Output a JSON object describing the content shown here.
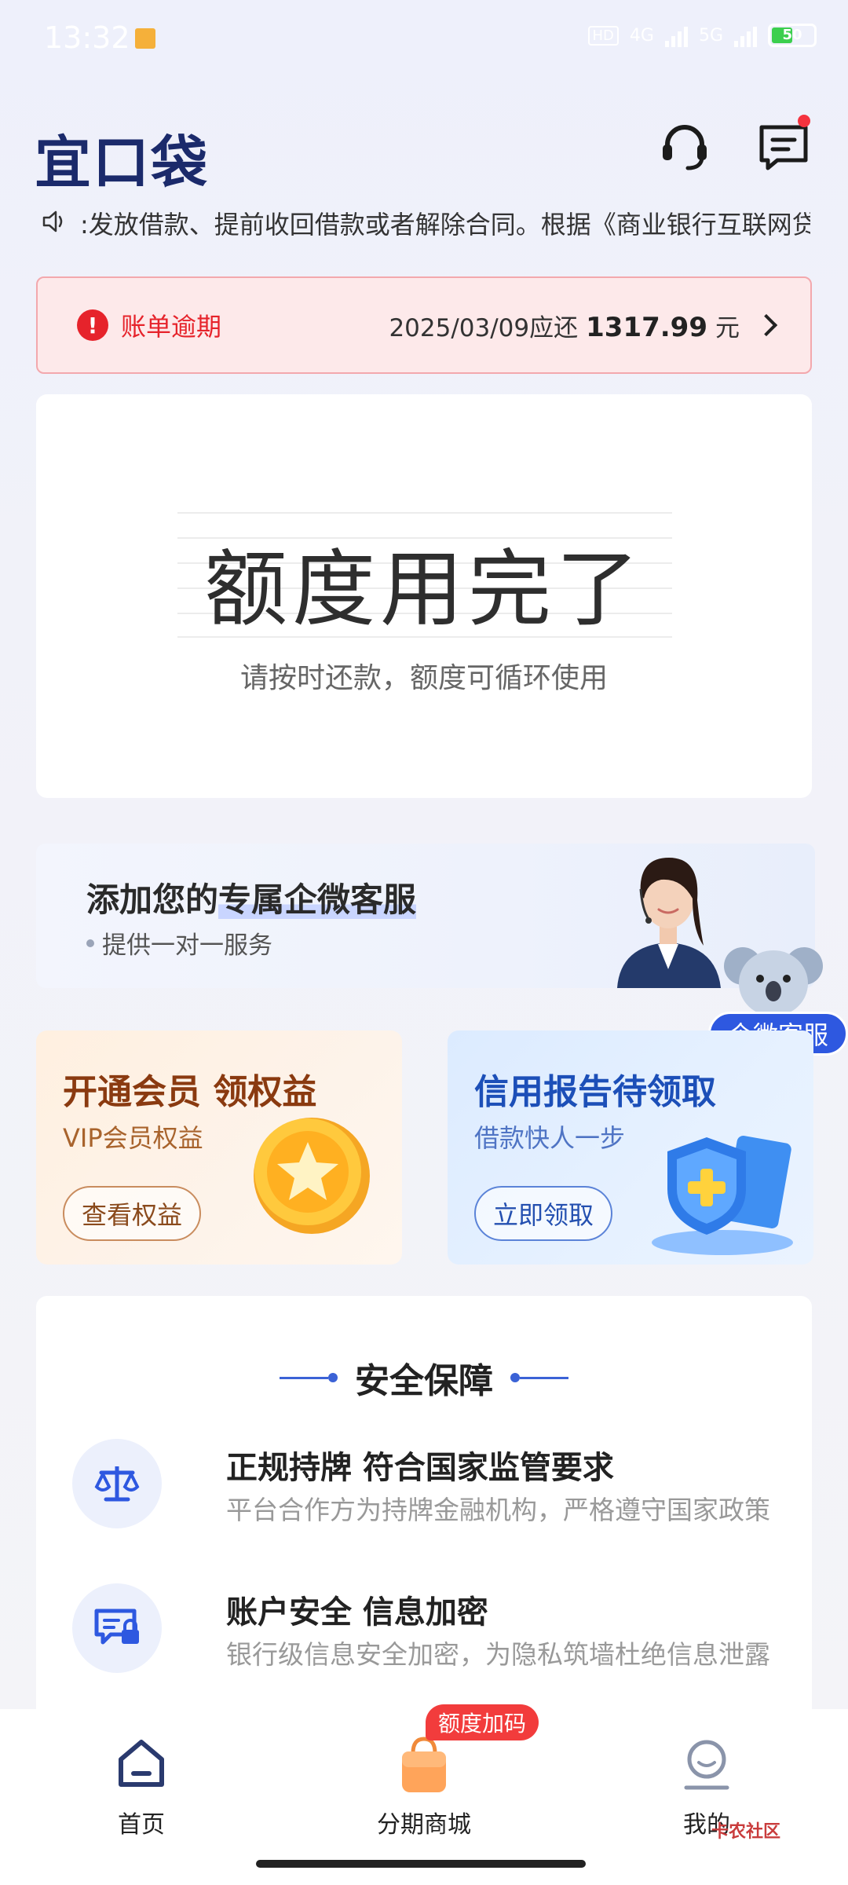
{
  "status_bar": {
    "time": "13:32",
    "network_1": "4G",
    "network_2": "5G",
    "hd": "HD",
    "battery": "50"
  },
  "header": {
    "logo": "宜口袋"
  },
  "announcement": {
    "text": ":发放借款、提前收回借款或者解除合同。根据《商业银行互联网贷款管理暂行办法》"
  },
  "overdue": {
    "label": "账单逾期",
    "due_date": "2025/03/09应还",
    "amount": "1317.99",
    "unit": "元"
  },
  "quota": {
    "title": "额度用完了",
    "subtitle": "请按时还款，额度可循环使用"
  },
  "cs_banner": {
    "title_prefix": "添加您的",
    "title_highlight": "专属企微客服",
    "subtitle": "提供一对一服务",
    "float_button": "企微客服"
  },
  "promos": {
    "vip": {
      "title": "开通会员 领权益",
      "subtitle": "VIP会员权益",
      "button": "查看权益"
    },
    "credit": {
      "title": "信用报告待领取",
      "subtitle": "借款快人一步",
      "button": "立即领取"
    }
  },
  "security": {
    "title": "安全保障",
    "items": [
      {
        "title": "正规持牌 符合国家监管要求",
        "subtitle": "平台合作方为持牌金融机构，严格遵守国家政策",
        "icon": "scale-icon"
      },
      {
        "title": "账户安全 信息加密",
        "subtitle": "银行级信息安全加密，为隐私筑墙杜绝信息泄露",
        "icon": "lock-card-icon"
      }
    ]
  },
  "bottom_nav": {
    "items": [
      {
        "label": "首页",
        "icon": "home-icon"
      },
      {
        "label": "分期商城",
        "icon": "shopping-bag-icon"
      },
      {
        "label": "我的",
        "icon": "profile-icon"
      }
    ],
    "badge": "额度加码"
  },
  "watermark": "卡农社区",
  "colors": {
    "brand_navy": "#1b2a6b",
    "alert_red": "#e6232b",
    "accent_blue": "#2e58e0"
  }
}
